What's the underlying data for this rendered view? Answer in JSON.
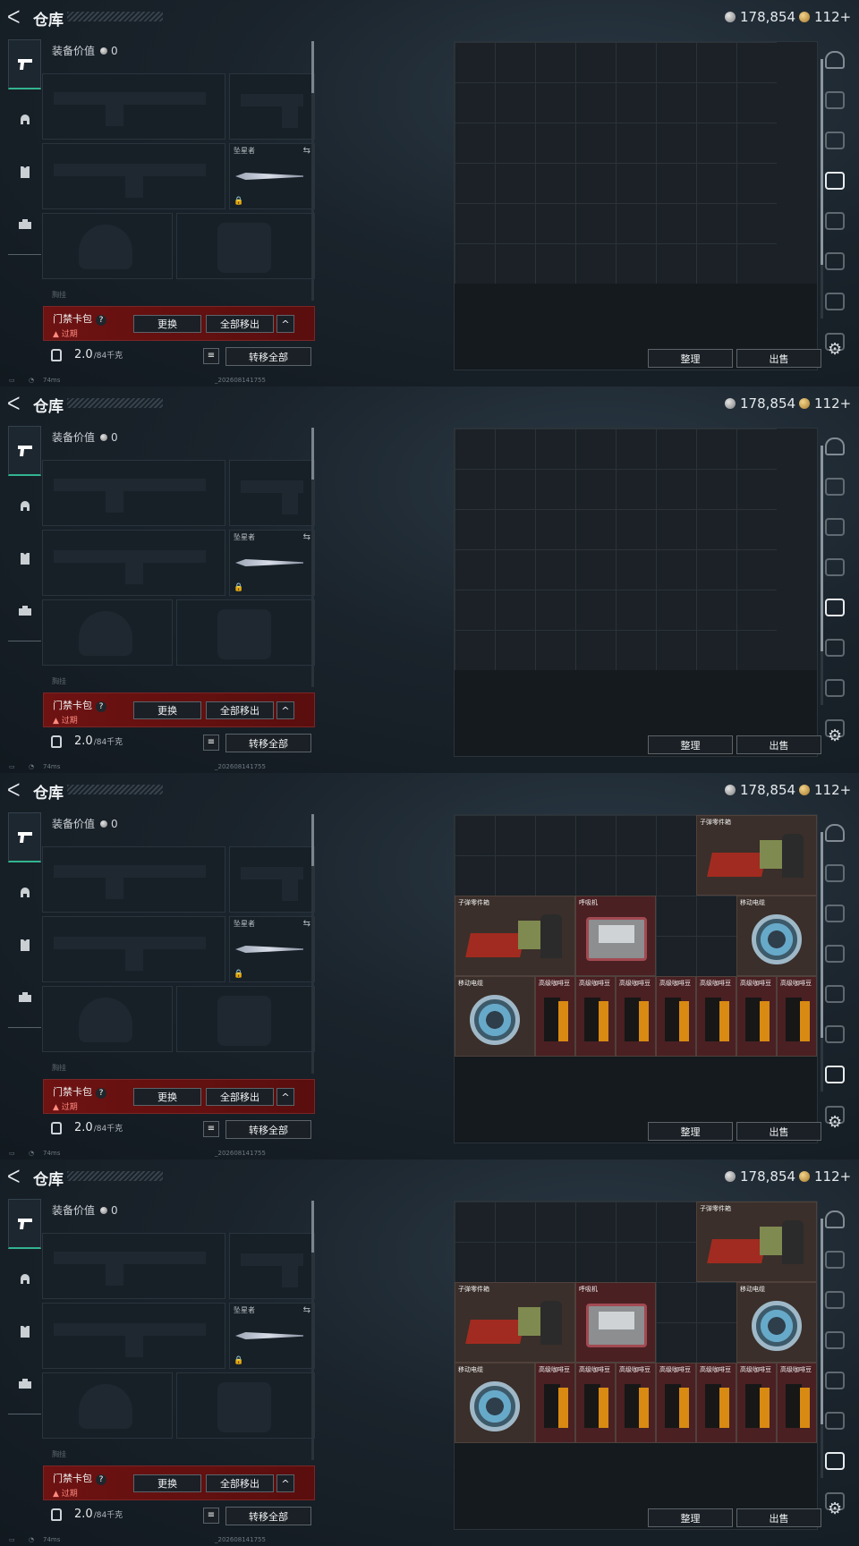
{
  "header": {
    "back_glyph": "ᐸ",
    "title": "仓库",
    "silver_amount": "178,854",
    "gold_amount": "112+"
  },
  "left_tabs": [
    {
      "name": "weapon-tab",
      "icon": "pistol-icon",
      "active": true
    },
    {
      "name": "armor-tab",
      "icon": "helmet-icon",
      "active": false
    },
    {
      "name": "rig-tab",
      "icon": "vest-icon",
      "active": false
    },
    {
      "name": "bag-tab",
      "icon": "backpack-icon",
      "active": false
    }
  ],
  "equipment": {
    "value_label": "装备价值",
    "value_amount": "0",
    "melee_name": "坠星者",
    "next_section_label": "胸挂"
  },
  "card": {
    "name": "门禁卡包",
    "help": "?",
    "status": "过期",
    "replace_label": "更换",
    "remove_all_label": "全部移出",
    "collapse_glyph": "^"
  },
  "footer": {
    "weight": "2.0",
    "weight_max": "/84千克",
    "list_glyph": "≡",
    "transfer_all_label": "转移全部"
  },
  "status": {
    "ping": "74ms",
    "build": "_202608141755"
  },
  "grid_actions": {
    "sort_label": "整理",
    "sell_label": "出售"
  },
  "right_icons": [
    "safe-icon",
    "tv-icon",
    "tv-icon",
    "tv-icon",
    "tv-icon",
    "tv-icon",
    "tv-icon",
    "tv-icon"
  ],
  "frames": [
    {
      "active_right_icon": 3,
      "items": []
    },
    {
      "active_right_icon": 4,
      "items": []
    },
    {
      "active_right_icon": 6,
      "items": [
        {
          "label": "子弹零件箱",
          "type": "ammo-parts"
        },
        {
          "label": "子弹零件箱",
          "type": "ammo-parts"
        },
        {
          "label": "呼吸机",
          "type": "ventilator"
        },
        {
          "label": "移动电缆",
          "type": "cable-reel"
        },
        {
          "label": "移动电缆",
          "type": "cable-reel"
        },
        {
          "label": "高级咖啡豆",
          "type": "coffee"
        },
        {
          "label": "高级咖啡豆",
          "type": "coffee"
        },
        {
          "label": "高级咖啡豆",
          "type": "coffee"
        },
        {
          "label": "高级咖啡豆",
          "type": "coffee"
        },
        {
          "label": "高级咖啡豆",
          "type": "coffee"
        },
        {
          "label": "高级咖啡豆",
          "type": "coffee"
        },
        {
          "label": "高级咖啡豆",
          "type": "coffee"
        }
      ]
    },
    {
      "active_right_icon": 6,
      "items": [
        {
          "label": "子弹零件箱",
          "type": "ammo-parts"
        },
        {
          "label": "子弹零件箱",
          "type": "ammo-parts"
        },
        {
          "label": "呼吸机",
          "type": "ventilator"
        },
        {
          "label": "移动电缆",
          "type": "cable-reel"
        },
        {
          "label": "移动电缆",
          "type": "cable-reel"
        },
        {
          "label": "高级咖啡豆",
          "type": "coffee"
        },
        {
          "label": "高级咖啡豆",
          "type": "coffee"
        },
        {
          "label": "高级咖啡豆",
          "type": "coffee"
        },
        {
          "label": "高级咖啡豆",
          "type": "coffee"
        },
        {
          "label": "高级咖啡豆",
          "type": "coffee"
        },
        {
          "label": "高级咖啡豆",
          "type": "coffee"
        },
        {
          "label": "高级咖啡豆",
          "type": "coffee"
        }
      ]
    }
  ]
}
